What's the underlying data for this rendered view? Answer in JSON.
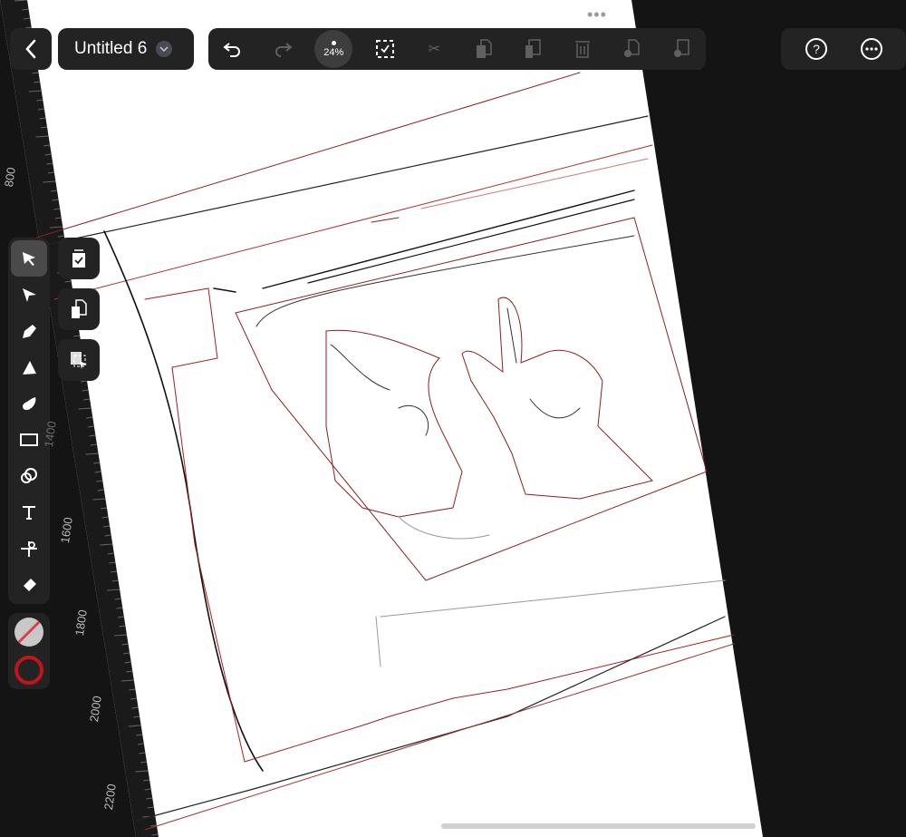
{
  "header": {
    "back_label": "Back",
    "document_title": "Untitled 6",
    "zoom_level": "24%"
  },
  "toolbar": {
    "icons": [
      "undo-icon",
      "redo-icon",
      "zoom-indicator",
      "select-all-icon",
      "cut-icon",
      "copy-icon",
      "paste-icon",
      "delete-icon",
      "duplicate-icon",
      "paste-in-place-icon"
    ]
  },
  "right_menu": {
    "icons": [
      "help-icon",
      "more-icon"
    ]
  },
  "tools": [
    "selection",
    "node",
    "pen",
    "pencil",
    "brush",
    "rectangle",
    "shape-builder",
    "text",
    "scissors",
    "eraser"
  ],
  "quick_actions": [
    "select-all",
    "duplicate",
    "select-same"
  ],
  "ruler": {
    "labels": [
      "800",
      "1400",
      "1600",
      "1800",
      "2000",
      "2200"
    ]
  },
  "colors": {
    "fill": "none",
    "stroke": "#c0161b",
    "accent": "#c0161b"
  }
}
